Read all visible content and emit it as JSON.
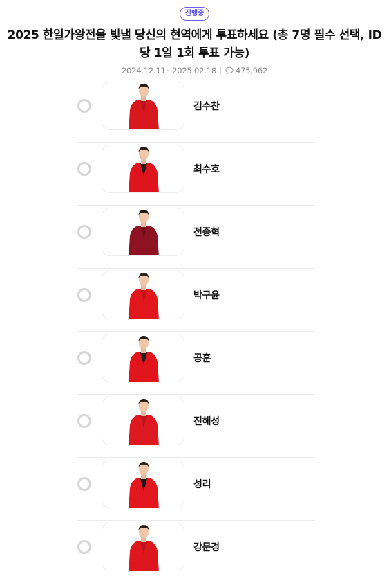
{
  "vote": {
    "status": "진행중",
    "title": "2025 한일가왕전을 빛낼 당신의 현역에게 투표하세요 (총 7명 필수 선택, ID당 1일 1회 투표 가능)",
    "period": "2024.12.11~2025.02.18",
    "comment_count": "475,962"
  },
  "candidates": [
    {
      "name": "김수찬",
      "outfit": "#d9171f",
      "inner": "#b8121a",
      "hair": "#2a1a14"
    },
    {
      "name": "최수호",
      "outfit": "#e0141c",
      "inner": "#1a1a1a",
      "hair": "#2b1d16"
    },
    {
      "name": "전종혁",
      "outfit": "#8e1322",
      "inner": "#6f0f1a",
      "hair": "#1e1612"
    },
    {
      "name": "박구윤",
      "outfit": "#e3161c",
      "inner": "#c5121a",
      "hair": "#222222"
    },
    {
      "name": "공훈",
      "outfit": "#e2151d",
      "inner": "#1c1c1c",
      "hair": "#241a15"
    },
    {
      "name": "진해성",
      "outfit": "#dd1820",
      "inner": "#c0131b",
      "hair": "#2a1c15"
    },
    {
      "name": "성리",
      "outfit": "#e4161e",
      "inner": "#161616",
      "hair": "#2d1e16"
    },
    {
      "name": "강문경",
      "outfit": "#de171f",
      "inner": "#bf121a",
      "hair": "#261b15"
    }
  ],
  "colors": {
    "accent": "#5a4be8",
    "radio_border": "#d6d6d6",
    "divider": "#ececec"
  },
  "icons": {
    "comment": "speech-bubble-icon"
  }
}
